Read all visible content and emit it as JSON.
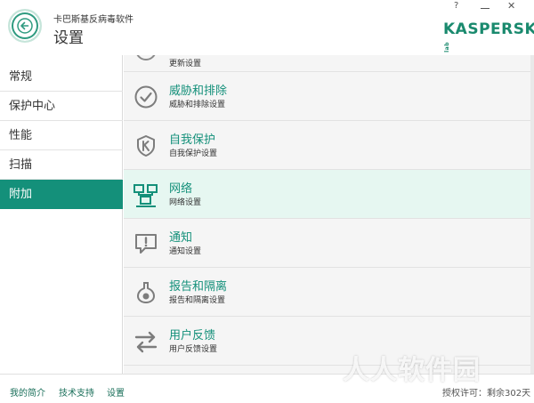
{
  "header": {
    "app_name": "卡巴斯基反病毒软件",
    "page_title": "设置",
    "help_label": "?",
    "close_label": "✕",
    "logo_text": "KASPERSKY",
    "logo_lab": "lab"
  },
  "sidebar": {
    "items": [
      {
        "label": "常规"
      },
      {
        "label": "保护中心"
      },
      {
        "label": "性能"
      },
      {
        "label": "扫描"
      },
      {
        "label": "附加"
      }
    ],
    "active_index": 4
  },
  "main": {
    "partial_top_sub": "更新设置",
    "items": [
      {
        "icon": "check-circle-icon",
        "title": "威胁和排除",
        "sub": "威胁和排除设置"
      },
      {
        "icon": "shield-k-icon",
        "title": "自我保护",
        "sub": "自我保护设置"
      },
      {
        "icon": "network-icon",
        "title": "网络",
        "sub": "网络设置"
      },
      {
        "icon": "notification-icon",
        "title": "通知",
        "sub": "通知设置"
      },
      {
        "icon": "flask-icon",
        "title": "报告和隔离",
        "sub": "报告和隔离设置"
      },
      {
        "icon": "arrows-exchange-icon",
        "title": "用户反馈",
        "sub": "用户反馈设置"
      }
    ],
    "selected_index": 2
  },
  "footer": {
    "my_profile": "我的简介",
    "support": "技术支持",
    "settings": "设置",
    "license": "授权许可：剩余302天"
  },
  "watermark": "人人软件园",
  "colors": {
    "accent": "#14907a",
    "selected_row": "#e6f7f1",
    "list_bg": "#f5f5f5"
  }
}
